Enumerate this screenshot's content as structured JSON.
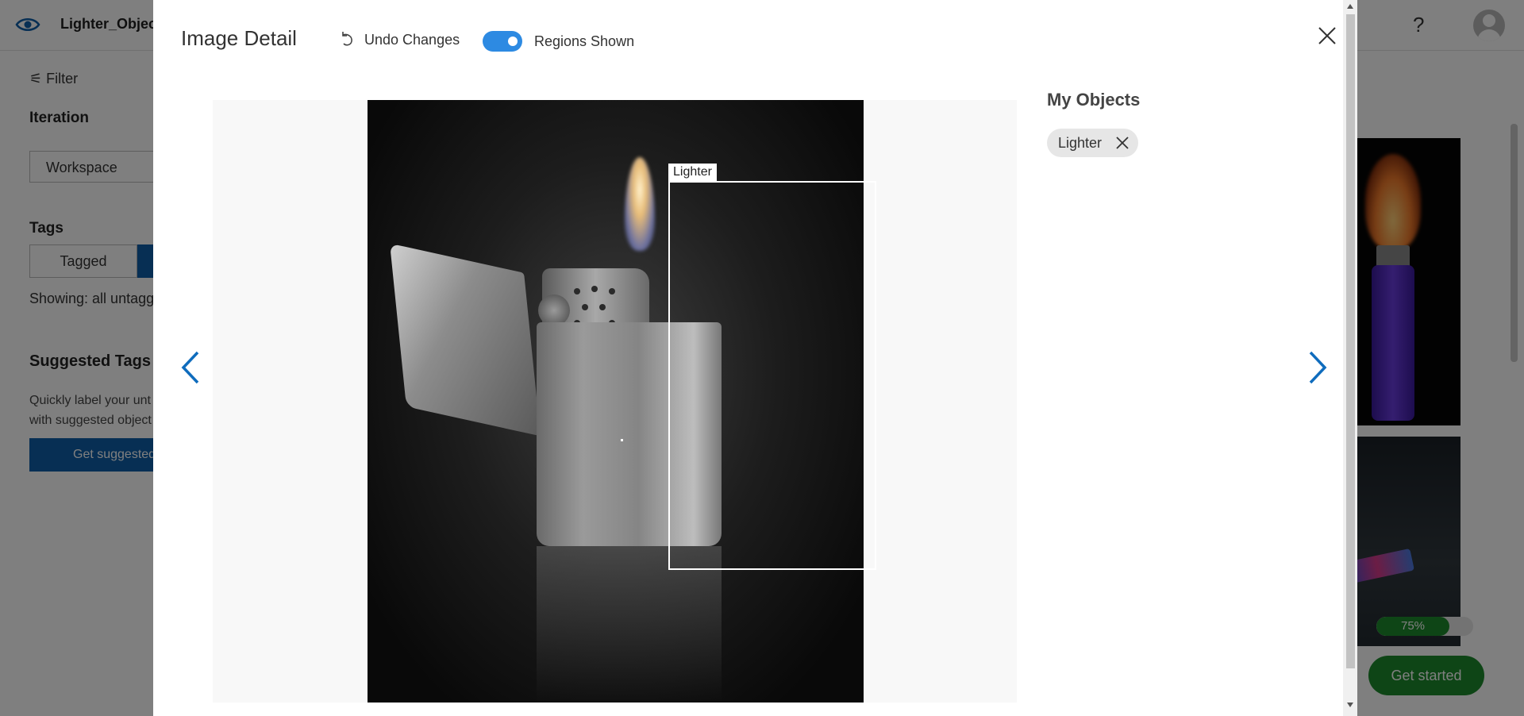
{
  "app": {
    "project_name": "Lighter_Object",
    "filter_label": "Filter",
    "iteration_heading": "Iteration",
    "iteration_value": "Workspace",
    "tags_heading": "Tags",
    "tagged_label": "Tagged",
    "showing_text": "Showing: all untagg",
    "suggested_heading": "Suggested Tags",
    "suggested_desc_line1": "Quickly label your unt",
    "suggested_desc_line2": "with suggested object",
    "get_suggested_label": "Get suggested",
    "progress_text": "75%",
    "progress_percent": 75,
    "get_started_label": "Get started"
  },
  "modal": {
    "title": "Image Detail",
    "undo_label": "Undo Changes",
    "regions_label": "Regions Shown",
    "regions_shown": true,
    "region_tag": "Lighter",
    "objects_title": "My Objects",
    "objects": [
      {
        "label": "Lighter"
      }
    ]
  },
  "colors": {
    "accent": "#2d8ae2",
    "nav_arrow": "#0f6cbd",
    "primary_button": "#0f5ea8",
    "success": "#1c8a2c"
  },
  "icons": {
    "logo": "eye-icon",
    "undo": "undo-icon",
    "close": "close-icon",
    "prev": "chevron-left-icon",
    "next": "chevron-right-icon",
    "help": "help-icon",
    "avatar": "user-avatar-icon",
    "filter": "filter-icon",
    "chip_remove": "remove-tag-icon"
  }
}
